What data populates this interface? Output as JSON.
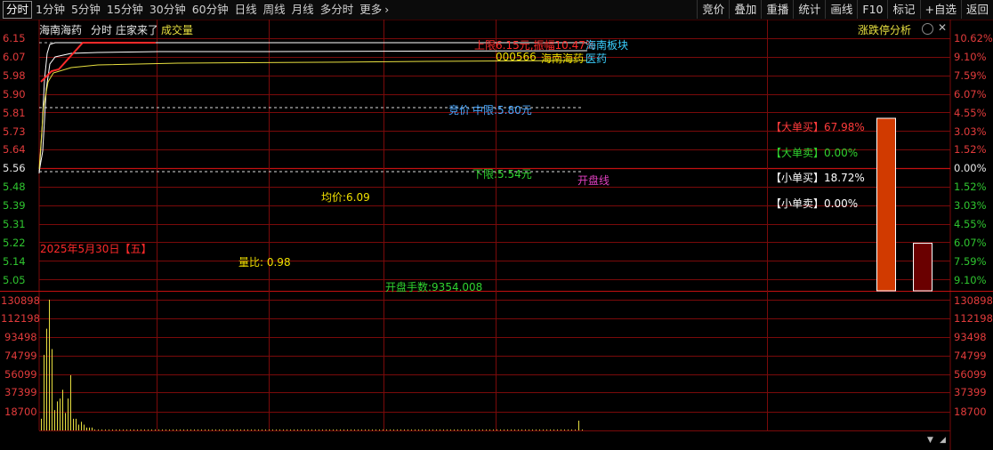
{
  "toolbar": {
    "tabs": [
      "分时",
      "1分钟",
      "5分钟",
      "15分钟",
      "30分钟",
      "60分钟",
      "日线",
      "周线",
      "月线",
      "多分时",
      "更多"
    ],
    "more_chevron": "›",
    "right_buttons": [
      "竞价",
      "叠加",
      "重播",
      "统计",
      "画线",
      "F10",
      "标记",
      "+自选",
      "返回"
    ]
  },
  "header": {
    "stock_name": "海南海药",
    "mode": "分时",
    "indicator": "庄家来了",
    "volume_label": "成交量",
    "right_title": "涨跌停分析"
  },
  "price_axis_left": [
    "6.15",
    "6.07",
    "5.98",
    "5.90",
    "5.81",
    "5.73",
    "5.64",
    "5.56",
    "5.48",
    "5.39",
    "5.31",
    "5.22",
    "5.14",
    "5.05"
  ],
  "pct_axis_right": [
    "10.62%",
    "9.10%",
    "7.59%",
    "6.07%",
    "4.55%",
    "3.03%",
    "1.52%",
    "0.00%",
    "1.52%",
    "3.03%",
    "4.55%",
    "6.07%",
    "7.59%",
    "9.10%"
  ],
  "volume_axis": [
    "130898",
    "112198",
    "93498",
    "74799",
    "56099",
    "37399",
    "18700"
  ],
  "annotations": {
    "upper_limit": "上限6.15元,振幅10.47%",
    "sector": "海南板块",
    "code": "000566",
    "name_overlay": "海南海药",
    "industry": "医药",
    "auction_prefix": "竞价",
    "mid_limit": "中限:5.80元",
    "lower_limit": "下限:5.54元",
    "open_line": "开盘线",
    "avg_price": "均价:6.09",
    "date": "2025年5月30日【五】",
    "volume_ratio": "量比: 0.98",
    "open_volume": "开盘手数:9354.008"
  },
  "order_stats": [
    {
      "label": "【大单买】",
      "value": "67.98%",
      "color": "#ff3b3b",
      "fraction": 0.6798
    },
    {
      "label": "【大单卖】",
      "value": "0.00%",
      "color": "#2fd22f",
      "fraction": 0.0
    },
    {
      "label": "【小单买】",
      "value": "18.72%",
      "color": "#ffffff",
      "fraction": 0.1872
    },
    {
      "label": "【小单卖】",
      "value": "0.00%",
      "color": "#ffffff",
      "fraction": 0.0
    }
  ],
  "colors": {
    "grid": "#7a0a0a",
    "price_line": "#ffffff",
    "avg_line": "#e8e040",
    "yellow": "#f0e000",
    "red": "#ff2a2a",
    "green": "#2fd22f",
    "blue": "#4aa8ff",
    "magenta": "#e040c0",
    "bar_big_buy": "#d13a00",
    "bar_small_buy": "#6a0000"
  }
}
